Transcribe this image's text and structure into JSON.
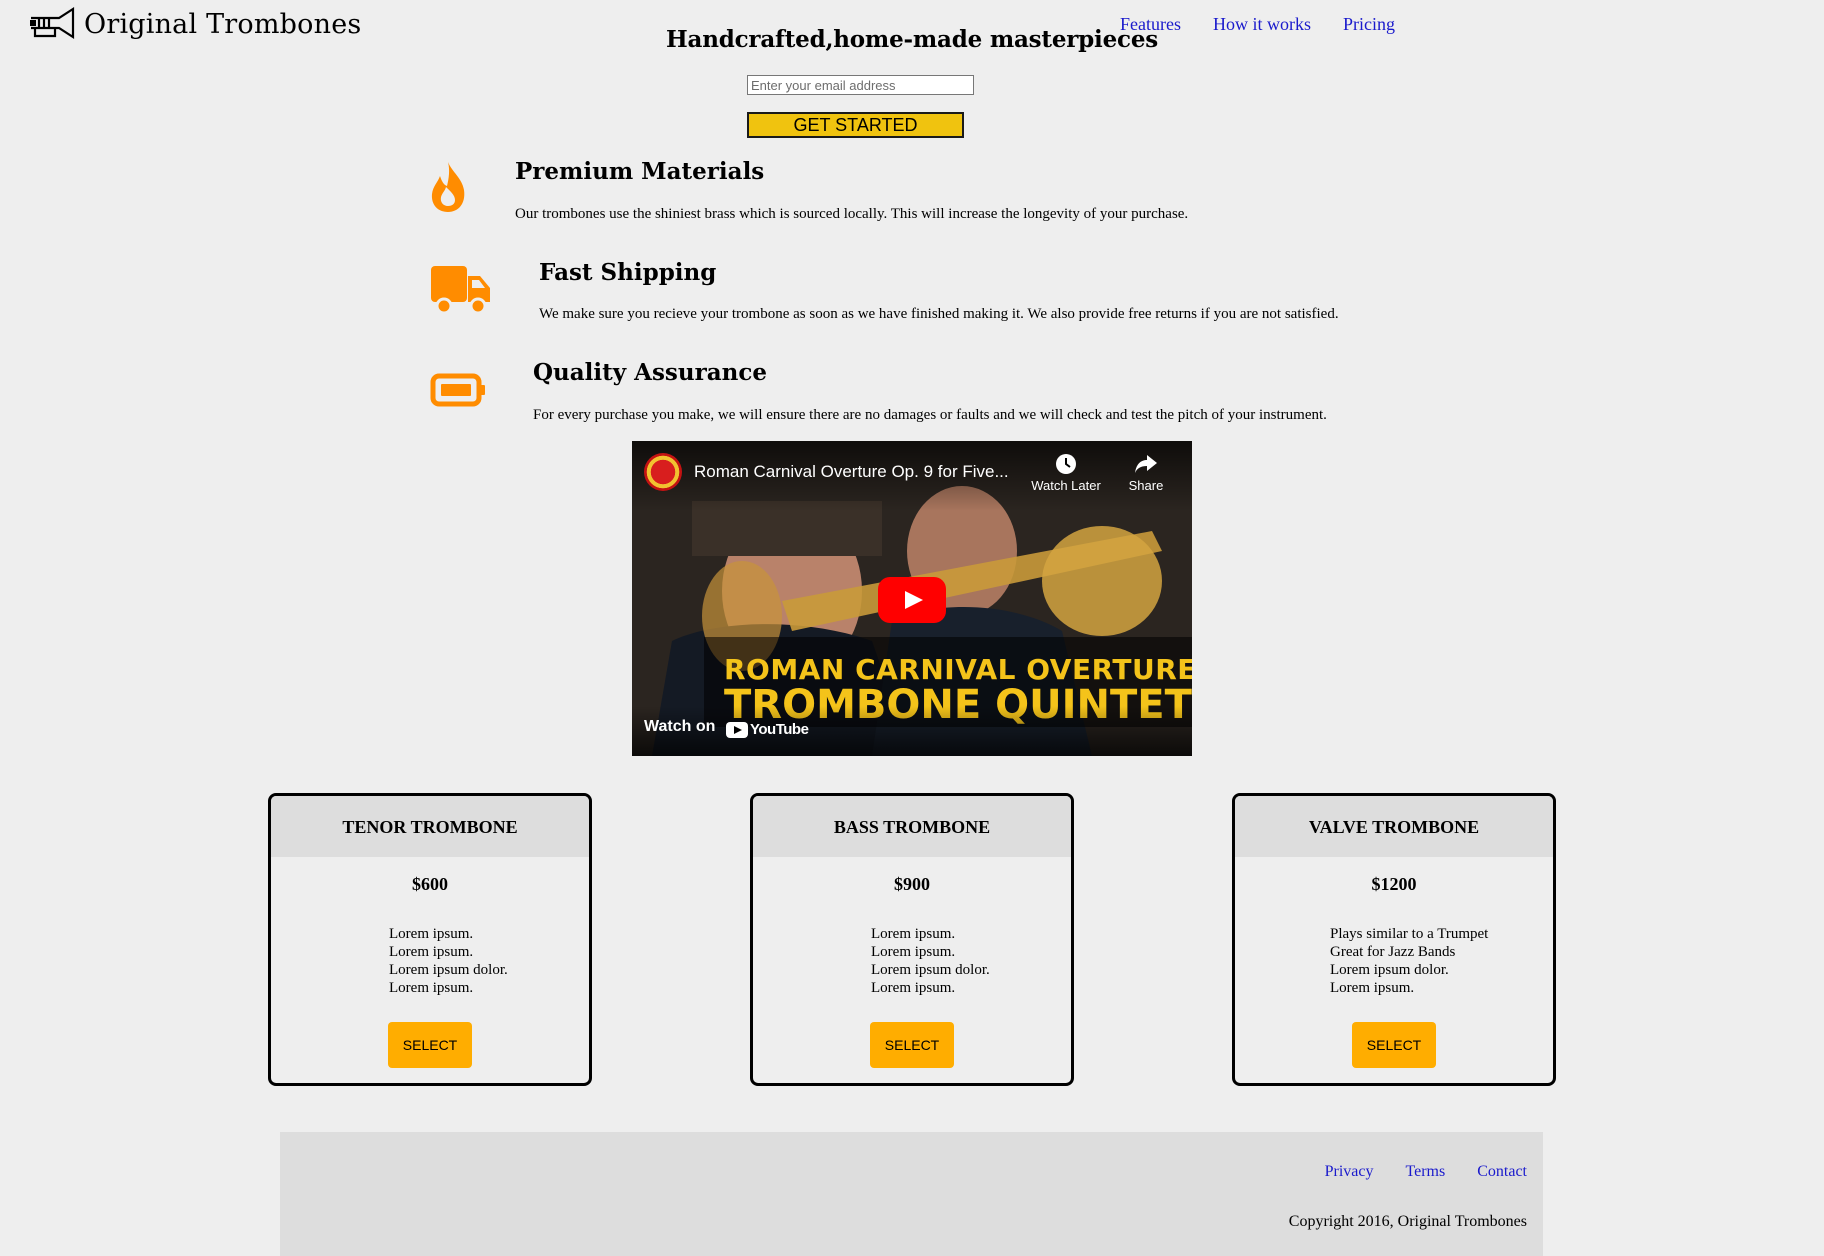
{
  "header": {
    "brand_name": "Original Trombones",
    "nav": [
      "Features",
      "How it works",
      "Pricing"
    ]
  },
  "hero": {
    "headline": "Handcrafted,home-made masterpieces",
    "email_placeholder": "Enter your email address",
    "cta_label": "GET STARTED"
  },
  "features": [
    {
      "icon": "fire-icon",
      "title": "Premium Materials",
      "description": "Our trombones use the shiniest brass which is sourced locally. This will increase the longevity of your purchase."
    },
    {
      "icon": "truck-icon",
      "title": "Fast Shipping",
      "description": "We make sure you recieve your trombone as soon as we have finished making it. We also provide free returns if you are not satisfied."
    },
    {
      "icon": "battery-icon",
      "title": "Quality Assurance",
      "description": "For every purchase you make, we will ensure there are no damages or faults and we will check and test the pitch of your instrument."
    }
  ],
  "video": {
    "title": "Roman Carnival Overture Op. 9 for Five...",
    "watch_later": "Watch Later",
    "share": "Share",
    "banner_line1": "ROMAN CARNIVAL OVERTURE",
    "banner_line2": "TROMBONE QUINTET",
    "watch_on": "Watch on",
    "youtube": "YouTube"
  },
  "plans": [
    {
      "name": "TENOR TROMBONE",
      "price": "$600",
      "features": [
        "Lorem ipsum.",
        "Lorem ipsum.",
        "Lorem ipsum dolor.",
        "Lorem ipsum."
      ],
      "select_label": "SELECT"
    },
    {
      "name": "BASS TROMBONE",
      "price": "$900",
      "features": [
        "Lorem ipsum.",
        "Lorem ipsum.",
        "Lorem ipsum dolor.",
        "Lorem ipsum."
      ],
      "select_label": "SELECT"
    },
    {
      "name": "VALVE TROMBONE",
      "price": "$1200",
      "features": [
        "Plays similar to a Trumpet",
        "Great for Jazz Bands",
        "Lorem ipsum dolor.",
        "Lorem ipsum."
      ],
      "select_label": "SELECT"
    }
  ],
  "footer": {
    "links": [
      "Privacy",
      "Terms",
      "Contact"
    ],
    "copyright": "Copyright 2016, Original Trombones"
  },
  "colors": {
    "accent_orange": "#ff8c00",
    "cta_yellow": "#f0c30f",
    "select_orange": "#ffad00",
    "link_blue": "#1a1acc"
  }
}
